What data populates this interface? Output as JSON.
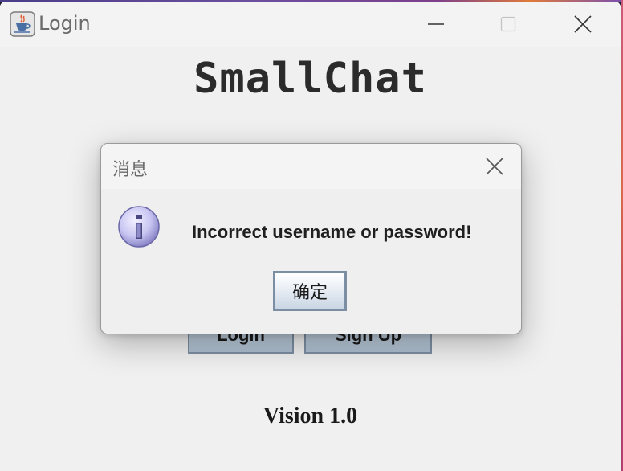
{
  "window": {
    "title": "Login",
    "icon": "java-cup-icon",
    "controls": [
      "minimize-icon",
      "maximize-icon",
      "close-icon"
    ]
  },
  "app": {
    "title": "SmallChat",
    "login_label": "Login",
    "signup_label": "Sign Up",
    "version": "Vision 1.0"
  },
  "dialog": {
    "title": "消息",
    "icon": "info-icon",
    "message": "Incorrect username or password!",
    "ok_label": "确定"
  },
  "colors": {
    "window_bg": "#f0f0f0",
    "button_bg": "#b8c8d9",
    "button_border": "#7d8fa3",
    "info_icon": "#c9c6f2"
  }
}
